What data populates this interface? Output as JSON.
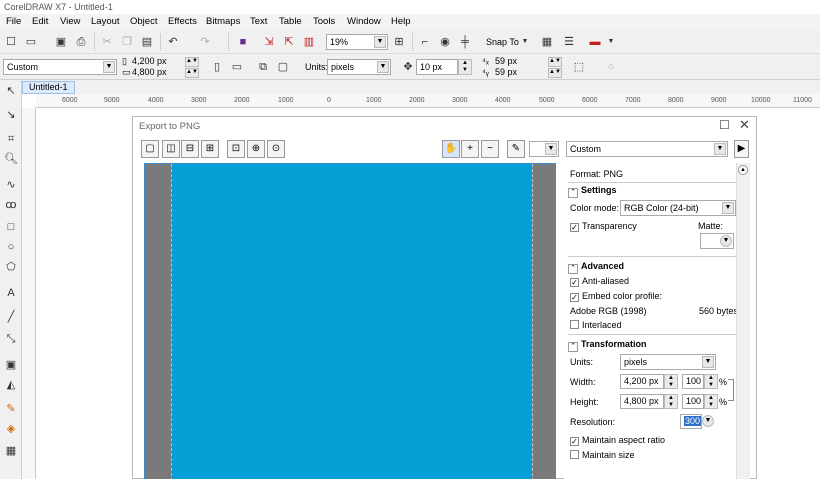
{
  "window": {
    "title": "CorelDRAW X7 - Untitled-1"
  },
  "menu": [
    "File",
    "Edit",
    "View",
    "Layout",
    "Object",
    "Effects",
    "Bitmaps",
    "Text",
    "Table",
    "Tools",
    "Window",
    "Help"
  ],
  "toolbar": {
    "zoom": "19%",
    "snap_to": "Snap To"
  },
  "propbar": {
    "preset": "Custom",
    "width": "4,200 px",
    "height": "4,800 px",
    "units_label": "Units:",
    "units": "pixels",
    "nudge": "10 px",
    "dup_x": "59 px",
    "dup_y": "59 px"
  },
  "tabs": [
    "Untitled-1"
  ],
  "ruler_labels": [
    "6000",
    "5000",
    "4000",
    "3000",
    "2000",
    "1000",
    "0",
    "1000",
    "2000",
    "3000",
    "4000",
    "5000",
    "6000",
    "7000",
    "8000",
    "9000",
    "10000",
    "11000"
  ],
  "dialog": {
    "title": "Export to PNG",
    "preset": "Custom",
    "format": "Format: PNG",
    "settings": {
      "header": "Settings",
      "color_mode_label": "Color mode:",
      "color_mode": "RGB Color (24-bit)",
      "transparency": "Transparency",
      "matte": "Matte:"
    },
    "advanced": {
      "header": "Advanced",
      "anti_aliased": "Anti-aliased",
      "embed_profile": "Embed color profile:",
      "profile_name": "Adobe RGB (1998)",
      "profile_size": "560 bytes",
      "interlaced": "Interlaced"
    },
    "transformation": {
      "header": "Transformation",
      "units_label": "Units:",
      "units": "pixels",
      "width_label": "Width:",
      "width": "4,200 px",
      "width_pct": "100",
      "height_label": "Height:",
      "height": "4,800 px",
      "height_pct": "100",
      "pct": "%",
      "resolution_label": "Resolution:",
      "resolution": "300",
      "maintain_aspect": "Maintain aspect ratio",
      "maintain_size": "Maintain size"
    }
  }
}
